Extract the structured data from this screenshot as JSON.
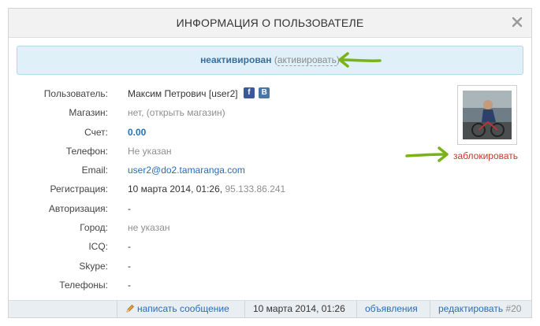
{
  "dialog": {
    "title": "ИНФОРМАЦИЯ О ПОЛЬЗОВАТЕЛЕ",
    "close_icon": "close-icon"
  },
  "status": {
    "value": "неактивирован",
    "open_paren": "(",
    "activate_label": "активировать",
    "close_paren": ")"
  },
  "fields": {
    "user": {
      "label": "Пользователь:",
      "name": "Максим Петрович",
      "login": "[user2]"
    },
    "shop": {
      "label": "Магазин:",
      "value": "нет, (открыть магазин)"
    },
    "balance": {
      "label": "Счет:",
      "value": "0.00"
    },
    "phone": {
      "label": "Телефон:",
      "value": "Не указан"
    },
    "email": {
      "label": "Email:",
      "value": "user2@do2.tamaranga.com"
    },
    "registration": {
      "label": "Регистрация:",
      "date": "10 марта 2014, 01:26,",
      "ip": "95.133.86.241"
    },
    "authorization": {
      "label": "Авторизация:",
      "value": "-"
    },
    "city": {
      "label": "Город:",
      "value": "не указан"
    },
    "icq": {
      "label": "ICQ:",
      "value": "-"
    },
    "skype": {
      "label": "Skype:",
      "value": "-"
    },
    "phones": {
      "label": "Телефоны:",
      "value": "-"
    }
  },
  "social": {
    "facebook_letter": "f",
    "vk_letter": "B"
  },
  "block_label": "заблокировать",
  "footer": {
    "write_message": "написать сообщение",
    "date": "10 марта 2014, 01:26",
    "listings": "объявления",
    "edit": "редактировать",
    "id": "#20"
  },
  "colors": {
    "accent_arrow": "#7ab317",
    "link": "#2a6db5",
    "danger": "#c0392b",
    "status_bg": "#dff0f9"
  }
}
